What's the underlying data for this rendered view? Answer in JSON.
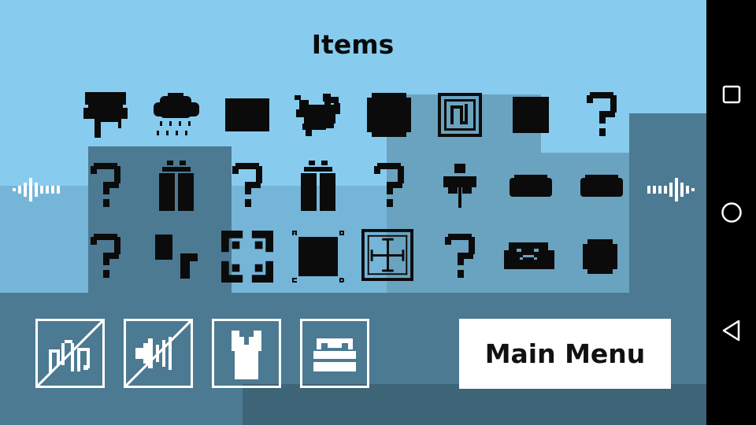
{
  "screen": {
    "title": "Items"
  },
  "colors": {
    "sky": "#87ccef",
    "hill_light": "#75b5d8",
    "hill_mid": "#6aa3c0",
    "hill_dark": "#4c7a92",
    "ground": "#3e6478",
    "selection": "#4c7a92",
    "icon_black": "#0b0b0b",
    "button_white": "#ffffff"
  },
  "items": {
    "row1": [
      {
        "name": "paint-roller-icon"
      },
      {
        "name": "rain-cloud-icon"
      },
      {
        "name": "black-rectangle-icon"
      },
      {
        "name": "splat-creature-icon"
      },
      {
        "name": "black-blob-icon"
      },
      {
        "name": "framed-music-icon"
      },
      {
        "name": "black-square-icon"
      },
      {
        "name": "question-mark-icon"
      }
    ],
    "row2": [
      {
        "name": "question-mark-icon"
      },
      {
        "name": "battery-icon"
      },
      {
        "name": "question-mark-icon"
      },
      {
        "name": "battery-icon"
      },
      {
        "name": "question-mark-icon"
      },
      {
        "name": "flower-sprite-icon"
      },
      {
        "name": "bread-loaf-icon"
      },
      {
        "name": "bread-loaf-icon"
      }
    ],
    "row3": [
      {
        "name": "question-mark-icon"
      },
      {
        "name": "tetromino-icon"
      },
      {
        "name": "four-corners-frame-icon"
      },
      {
        "name": "abcd-square-icon"
      },
      {
        "name": "crosshair-frame-icon"
      },
      {
        "name": "question-mark-icon"
      },
      {
        "name": "frowning-rock-icon"
      },
      {
        "name": "rounded-square-icon"
      }
    ]
  },
  "controls": {
    "music_toggle": {
      "icon": "music-off-icon"
    },
    "sound_toggle": {
      "icon": "sound-off-icon"
    },
    "shirt": {
      "icon": "shirt-icon"
    },
    "items_box": {
      "icon": "toolbox-icon"
    },
    "main_menu_label": "Main Menu"
  },
  "navigation": {
    "prev": {
      "icon": "prev-page-arrow-icon"
    },
    "next": {
      "icon": "next-page-arrow-icon"
    }
  },
  "system_nav": {
    "recents": {
      "icon": "square-recents-icon"
    },
    "home": {
      "icon": "circle-home-icon"
    },
    "back": {
      "icon": "triangle-back-icon"
    }
  }
}
